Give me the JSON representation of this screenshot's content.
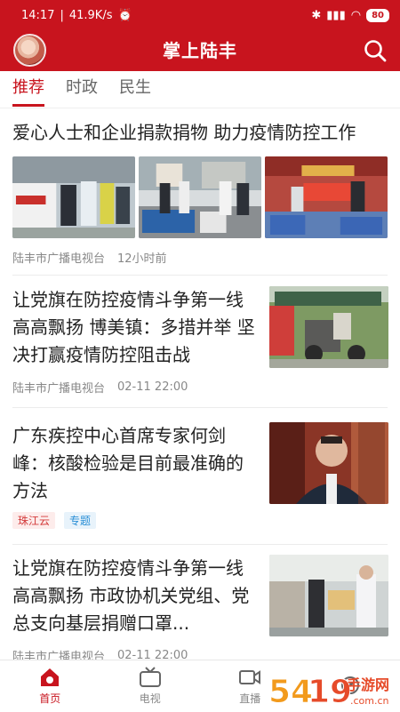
{
  "status": {
    "time": "14:17",
    "speed": "41.9K/s",
    "battery": "80"
  },
  "header": {
    "title": "掌上陆丰"
  },
  "tabs": [
    {
      "label": "推荐",
      "active": true
    },
    {
      "label": "时政"
    },
    {
      "label": "民生"
    }
  ],
  "items": [
    {
      "title": "爱心人士和企业捐款捐物 助力疫情防控工作",
      "source": "陆丰市广播电视台",
      "time": "12小时前"
    },
    {
      "title": "让党旗在防控疫情斗争第一线高高飘扬 博美镇：多措并举 坚决打赢疫情防控阻击战",
      "source": "陆丰市广播电视台",
      "time": "02-11 22:00"
    },
    {
      "title": "广东疾控中心首席专家何剑峰：核酸检验是目前最准确的方法",
      "tags": [
        "珠江云",
        "专题"
      ]
    },
    {
      "title": "让党旗在防控疫情斗争第一线高高飘扬 市政协机关党组、党总支向基层捐赠口罩...",
      "source": "陆丰市广播电视台",
      "time": "02-11 22:00"
    }
  ],
  "nav": [
    {
      "label": "首页",
      "icon": "home-icon",
      "active": true
    },
    {
      "label": "电视",
      "icon": "tv-icon"
    },
    {
      "label": "直播",
      "icon": "live-icon"
    }
  ],
  "watermark": "5419手游网",
  "colors": {
    "brand": "#c8141e",
    "tag_red": "#d33a3a",
    "tag_blue": "#2a8fd6"
  }
}
